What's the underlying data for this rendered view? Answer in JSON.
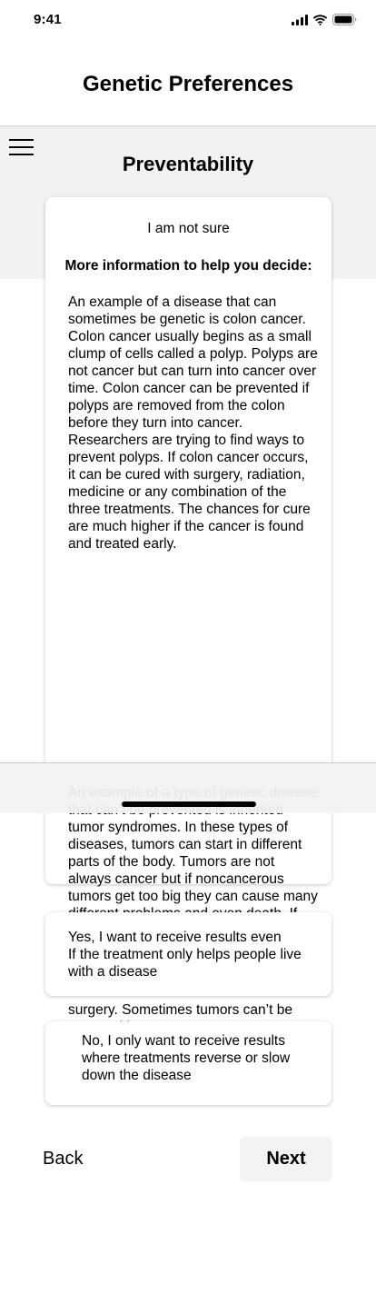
{
  "status_bar": {
    "time": "9:41",
    "icons": [
      "signal-icon",
      "wifi-icon",
      "battery-icon"
    ]
  },
  "header": {
    "title": "Genetic Preferences"
  },
  "menu": {
    "icon": "hamburger-menu-icon"
  },
  "section": {
    "title": "Preventability"
  },
  "info_card": {
    "option_label": "I am not sure",
    "heading": "More information to help you decide:",
    "paragraph_1": "An example of a disease that can sometimes be genetic is colon cancer. Colon cancer usually begins as a small clump of cells called a polyp. Polyps are not cancer but can turn into cancer over time. Colon cancer can be prevented if polyps are removed from the colon before they turn into cancer. Researchers are trying to find ways to prevent polyps. If colon cancer occurs, it can be cured with surgery, radiation, medicine or any combination of the three treatments. The chances for cure are much higher if the cancer is found and treated early.",
    "paragraph_2": "An example of a type of genetic disease that can’t be prevented is inherited tumor syndromes. In these types of diseases, tumors can start in different parts of the body. Tumors are not always cancer but if noncancerous tumors get too big they can cause many different problems and even death. If tumors occur, they can sometimes be",
    "paragraph_3": "surgery. Sometimes tumors can’t be removed by surgery."
  },
  "options": {
    "yes_line_1": "Yes, I want to receive results even",
    "yes_line_2": "If the treatment only helps people live with a disease",
    "no": "No, I only want to receive results where treatments reverse or slow down the disease"
  },
  "footer": {
    "back_label": "Back",
    "next_label": "Next"
  }
}
